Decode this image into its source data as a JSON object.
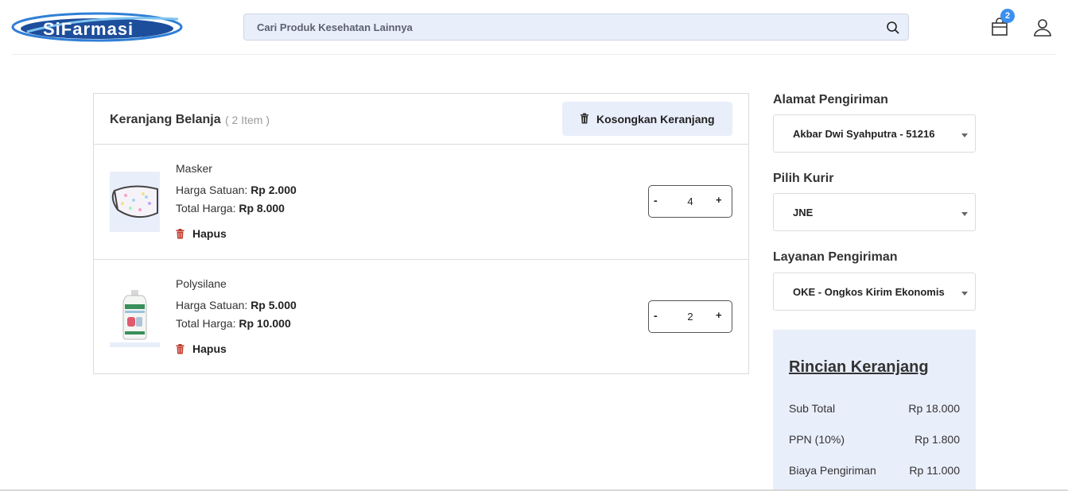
{
  "header": {
    "logo_text": "SiFarmasi",
    "search_placeholder": "Cari Produk Kesehatan Lainnya",
    "cart_badge": "2"
  },
  "cart": {
    "title": "Keranjang Belanja",
    "count_label": "( 2 Item )",
    "empty_button_label": "Kosongkan Keranjang",
    "unit_price_label": "Harga Satuan:",
    "total_price_label": "Total Harga:",
    "remove_label": "Hapus",
    "items": [
      {
        "name": "Masker",
        "unit_price": "Rp 2.000",
        "total_price": "Rp 8.000",
        "qty": "4",
        "minus": "-",
        "plus": "+"
      },
      {
        "name": "Polysilane",
        "unit_price": "Rp 5.000",
        "total_price": "Rp 10.000",
        "qty": "2",
        "minus": "-",
        "plus": "+"
      }
    ]
  },
  "shipping": {
    "address_label": "Alamat Pengiriman",
    "address_value": "Akbar Dwi Syahputra - 51216",
    "courier_label": "Pilih Kurir",
    "courier_value": "JNE",
    "service_label": "Layanan Pengiriman",
    "service_value": "OKE - Ongkos Kirim Ekonomis"
  },
  "summary": {
    "title": "Rincian Keranjang",
    "rows": [
      {
        "label": "Sub Total",
        "value": "Rp 18.000"
      },
      {
        "label": "PPN (10%)",
        "value": "Rp 1.800"
      },
      {
        "label": "Biaya Pengiriman",
        "value": "Rp 11.000"
      }
    ]
  },
  "colors": {
    "accent": "#3b8ff0",
    "panel_bg": "#e9eefb",
    "logo_blue": "#1d4e9c",
    "trash_red": "#c0392b"
  }
}
